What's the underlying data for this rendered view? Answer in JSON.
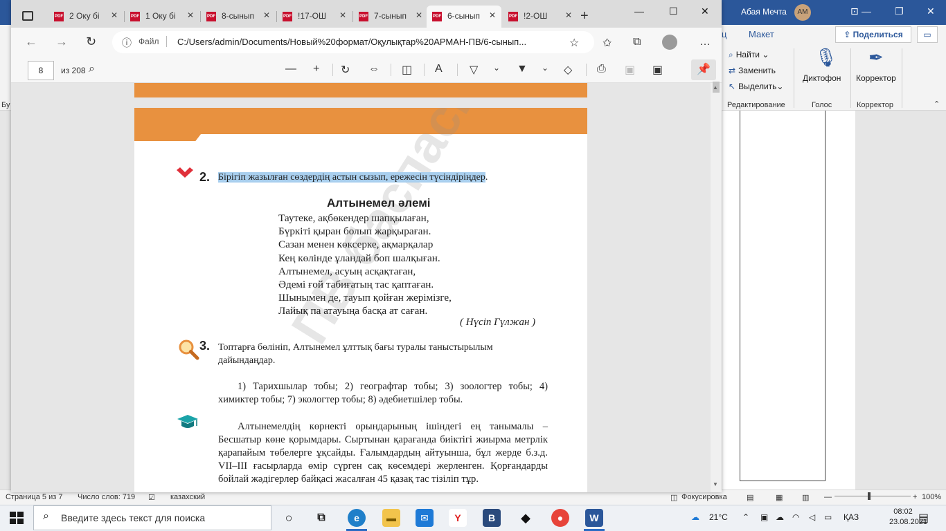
{
  "word": {
    "user_name": "Абая Мечта",
    "avatar_initials": "АМ",
    "tabs": [
      "ц",
      "Макет"
    ],
    "share_label": "Поделиться",
    "ribbon": {
      "find": "Найти",
      "replace": "Заменить",
      "select": "Выделить",
      "dictation": "Диктофон",
      "editor": "Корректор",
      "groups": [
        "Редактирование",
        "Голос",
        "Корректор"
      ],
      "left_cut": "Бу"
    },
    "status": {
      "page": "Страница 5 из 7",
      "words": "Число слов: 719",
      "language": "казахский",
      "focus": "Фокусировка",
      "zoom": "100%"
    }
  },
  "browser": {
    "tabs": [
      {
        "label": "2 Оку бі",
        "active": false
      },
      {
        "label": "1 Оку бі",
        "active": false
      },
      {
        "label": "8-сынып",
        "active": false
      },
      {
        "label": "!17-ОШ",
        "active": false
      },
      {
        "label": "7-сынып",
        "active": false
      },
      {
        "label": "6-сынып",
        "active": true
      },
      {
        "label": "!2-ОШ",
        "active": false
      }
    ],
    "url_scheme_label": "Файл",
    "url": "C:/Users/admin/Documents/Новый%20формат/Оқулықтар%20АРМАН-ПВ/6-сынып...",
    "pdf_toolbar": {
      "page_number": "8",
      "page_total": "из 208"
    }
  },
  "pdf": {
    "watermark": "ПВ баспасы",
    "task2": {
      "number": "2.",
      "text_highlighted": "Бірігіп жазылған сөздердің астын сызып, ережесін түсіндіріңдер",
      "text_end": "."
    },
    "poem": {
      "title": "Алтынемел әлемі",
      "lines": [
        "Таутеке, ақбөкендер шапқылаған,",
        "Бүркіті қыран болып жарқыраған.",
        "Сазан менен көксерке, ақмарқалар",
        "Кең көлінде ұландай боп шалқыған.",
        "Алтынемел, асуың асқақтаған,",
        "Әдемі ғой табиғатың тас қаптаған.",
        "Шынымен де, тауып қойған жерімізге,",
        "Лайық па атауыңа басқа ат саған."
      ],
      "author": "( Нүсіп Гүлжан )"
    },
    "task3": {
      "number": "3.",
      "text": "Топтарға бөлініп, Алтынемел ұлттық бағы туралы таныстырылым дайындаңдар.",
      "groups": "1) Тарихшылар тобы; 2) географтар тобы; 3) зоологтер тобы; 4) химиктер тобы; 7) экологтер тобы; 8) әдебиетшілер тобы."
    },
    "paragraph": "Алтынемелдің көрнекті орындарының ішіндегі ең танымалы – Бесшатыр көне қорымдары. Сыртынан қарағанда биіктігі жиырма метрлік қарапайым төбелерге ұқсайды. Ғалымдардың айтуынша, бұл жерде б.з.д. VII–III ғасырларда өмір сүрген сақ көсемдері жерленген. Қорғандарды бойлай жәдігерлер байқасі жасалған 45 қазақ тас тізіліп тұр.",
    "colors": {
      "band": "#e8913f",
      "highlight": "#a9cfee"
    }
  },
  "taskbar": {
    "search_placeholder": "Введите здесь текст для поиска",
    "weather": "21°C",
    "language": "ҚАЗ",
    "time": "08:02",
    "date": "23.08.2021"
  }
}
